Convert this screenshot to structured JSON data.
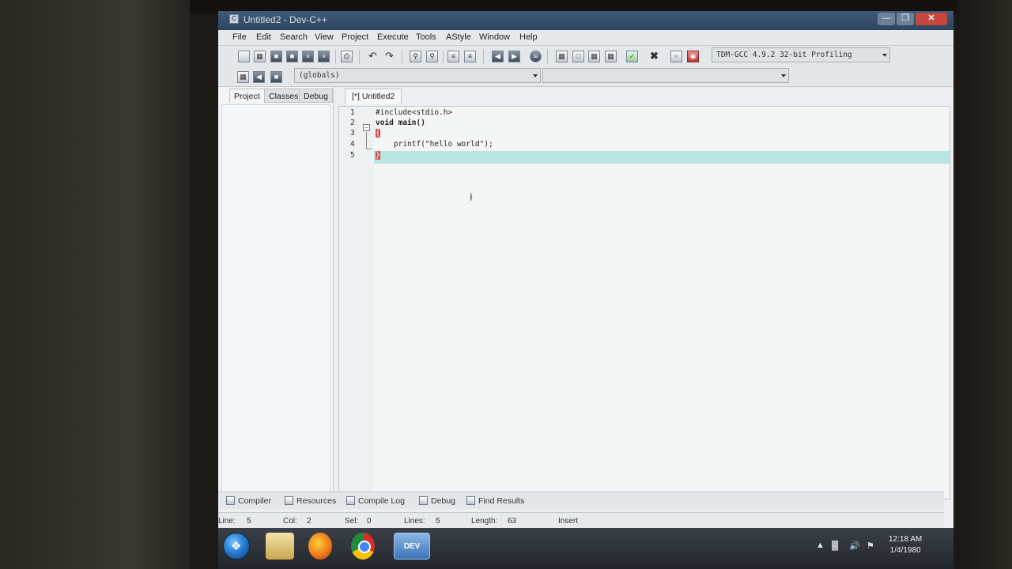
{
  "window": {
    "title": "Untitled2 - Dev-C++",
    "icon_label": "C"
  },
  "menu": [
    "File",
    "Edit",
    "Search",
    "View",
    "Project",
    "Execute",
    "Tools",
    "AStyle",
    "Window",
    "Help"
  ],
  "toolbar": {
    "compiler_select": "TDM-GCC 4.9.2 32-bit Profiling",
    "scope_select": "(globals)",
    "member_select": ""
  },
  "left_panel": {
    "tabs": [
      "Project",
      "Classes",
      "Debug"
    ]
  },
  "editor": {
    "tab_label": "[*] Untitled2",
    "line_numbers": [
      "1",
      "2",
      "3",
      "4",
      "5"
    ],
    "code_lines": [
      "#include<stdio.h>",
      "void main()",
      "{",
      "    printf(\"hello world\");",
      "}"
    ]
  },
  "bottom_tabs": [
    "Compiler",
    "Resources",
    "Compile Log",
    "Debug",
    "Find Results"
  ],
  "status": {
    "line_label": "Line:",
    "line_value": "5",
    "col_label": "Col:",
    "col_value": "2",
    "sel_label": "Sel:",
    "sel_value": "0",
    "lines_label": "Lines:",
    "lines_value": "5",
    "length_label": "Length:",
    "length_value": "63",
    "mode": "Insert"
  },
  "taskbar": {
    "devcpp_label": "DEV",
    "time": "12:18 AM",
    "date": "1/4/1980"
  },
  "colors": {
    "active_line": "#b9e6e3",
    "brace_highlight": "#d64a4a",
    "close_button": "#c6473e"
  }
}
